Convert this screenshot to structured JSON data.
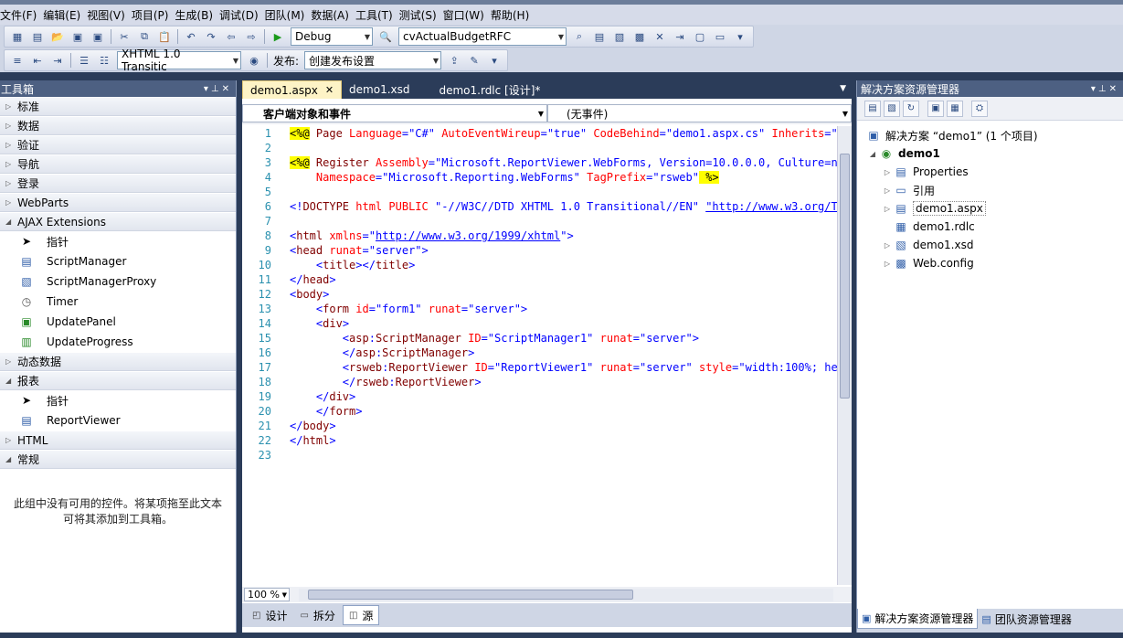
{
  "menu": [
    "文件(F)",
    "编辑(E)",
    "视图(V)",
    "项目(P)",
    "生成(B)",
    "调试(D)",
    "团队(M)",
    "数据(A)",
    "工具(T)",
    "测试(S)",
    "窗口(W)",
    "帮助(H)"
  ],
  "toolbar1": {
    "config": "Debug",
    "project_combo": "cvActualBudgetRFC"
  },
  "toolbar2": {
    "doctype": "XHTML 1.0 Transitic",
    "publish_label": "发布:",
    "publish_combo": "创建发布设置"
  },
  "toolbox": {
    "title": "工具箱",
    "categories": {
      "standard": "标准",
      "data": "数据",
      "validation": "验证",
      "navigation": "导航",
      "login": "登录",
      "webparts": "WebParts",
      "ajax": "AJAX Extensions",
      "dynamic_data": "动态数据",
      "reporting": "报表",
      "html": "HTML",
      "general": "常规"
    },
    "ajax_items": [
      "指针",
      "ScriptManager",
      "ScriptManagerProxy",
      "Timer",
      "UpdatePanel",
      "UpdateProgress"
    ],
    "reporting_items": [
      "指针",
      "ReportViewer"
    ],
    "empty_message_line1": "此组中没有可用的控件。将某项拖至此文本",
    "empty_message_line2": "可将其添加到工具箱。"
  },
  "editor": {
    "tabs": [
      "demo1.aspx",
      "demo1.xsd",
      "demo1.rdlc [设计]*"
    ],
    "object_combo": "客户端对象和事件",
    "event_combo": "(无事件)",
    "zoom": "100 %",
    "view_tabs": [
      "设计",
      "拆分",
      "源"
    ],
    "line_numbers": [
      "1",
      "2",
      "3",
      "4",
      "5",
      "6",
      "7",
      "8",
      "9",
      "10",
      "11",
      "12",
      "13",
      "14",
      "15",
      "16",
      "17",
      "18",
      "19",
      "20",
      "21",
      "22",
      "23"
    ],
    "code": {
      "l1": {
        "a": "<%@",
        "b": " Page ",
        "c": "Language",
        "d": "=",
        "e": "\"C#\"",
        "f": " AutoEventWireup",
        "g": "=",
        "h": "\"true\"",
        "i": " CodeBehind",
        "j": "=",
        "k": "\"demo1.aspx.cs\"",
        "l": " Inherits",
        "m": "=",
        "n": "\""
      },
      "l3": {
        "a": "<%@",
        "b": " Register ",
        "c": "Assembly",
        "d": "=",
        "e": "\"Microsoft.ReportViewer.WebForms, Version=10.0.0.0, Culture=n"
      },
      "l4": {
        "a": "    Namespace",
        "b": "=",
        "c": "\"Microsoft.Reporting.WebForms\"",
        "d": " TagPrefix",
        "e": "=",
        "f": "\"rsweb\"",
        "g": " %>"
      },
      "l6": {
        "a": "<!",
        "b": "DOCTYPE",
        "c": " html ",
        "d": "PUBLIC",
        "e": " \"-//W3C//DTD XHTML 1.0 Transitional//EN\" ",
        "f": "\"http://www.w3.org/T"
      },
      "l8": {
        "a": "<",
        "b": "html",
        "c": " xmlns",
        "d": "=",
        "e": "\"",
        "f": "http://www.w3.org/1999/xhtml",
        "g": "\"",
        "h": ">"
      },
      "l9": {
        "a": "<",
        "b": "head",
        "c": " runat",
        "d": "=",
        "e": "\"server\"",
        "f": ">"
      },
      "l10": {
        "a": "    <",
        "b": "title",
        "c": "></",
        "d": "title",
        "e": ">"
      },
      "l11": {
        "a": "</",
        "b": "head",
        "c": ">"
      },
      "l12": {
        "a": "<",
        "b": "body",
        "c": ">"
      },
      "l13": {
        "a": "    <",
        "b": "form",
        "c": " id",
        "d": "=",
        "e": "\"form1\"",
        "f": " runat",
        "g": "=",
        "h": "\"server\"",
        "i": ">"
      },
      "l14": {
        "a": "    <",
        "b": "div",
        "c": ">"
      },
      "l15": {
        "a": "        <",
        "b": "asp",
        "c": ":",
        "d": "ScriptManager",
        "e": " ID",
        "f": "=",
        "g": "\"ScriptManager1\"",
        "h": " runat",
        "i": "=",
        "j": "\"server\"",
        "k": ">"
      },
      "l16": {
        "a": "        </",
        "b": "asp",
        "c": ":",
        "d": "ScriptManager",
        "e": ">"
      },
      "l17": {
        "a": "        <",
        "b": "rsweb",
        "c": ":",
        "d": "ReportViewer",
        "e": " ID",
        "f": "=",
        "g": "\"ReportViewer1\"",
        "h": " runat",
        "i": "=",
        "j": "\"server\"",
        "k": " style",
        "l": "=",
        "m": "\"width:100%; he"
      },
      "l18": {
        "a": "        </",
        "b": "rsweb",
        "c": ":",
        "d": "ReportViewer",
        "e": ">"
      },
      "l19": {
        "a": "    </",
        "b": "div",
        "c": ">"
      },
      "l20": {
        "a": "    </",
        "b": "form",
        "c": ">"
      },
      "l21": {
        "a": "</",
        "b": "body",
        "c": ">"
      },
      "l22": {
        "a": "</",
        "b": "html",
        "c": ">"
      }
    }
  },
  "solution": {
    "title": "解决方案资源管理器",
    "root": "解决方案 “demo1” (1 个项目)",
    "project": "demo1",
    "items": [
      "Properties",
      "引用",
      "demo1.aspx",
      "demo1.rdlc",
      "demo1.xsd",
      "Web.config"
    ],
    "bottom_tabs": [
      "解决方案资源管理器",
      "团队资源管理器"
    ]
  }
}
